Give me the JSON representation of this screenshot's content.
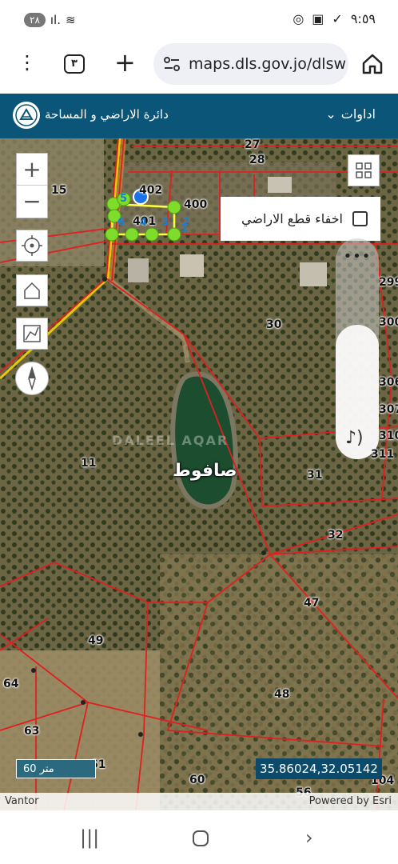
{
  "status": {
    "battery": "٢٨",
    "time": "٩:٥٩"
  },
  "browser": {
    "tab_count": "٣",
    "url": "maps.dls.gov.jo/dlsw"
  },
  "header": {
    "org_name": "دائرة الاراضي و المساحة",
    "tools_label": "اداوات"
  },
  "map": {
    "hide_parcels_label": "اخفاء قطع الاراضي",
    "place_name": "صافوط",
    "watermark": "DALEEL AQAR",
    "scale": "60 متر",
    "coordinates": "35.86024,32.05142",
    "attribution_left": "Vantor",
    "attribution_right": "Powered by Esri",
    "parcels": [
      {
        "id": "p27",
        "label": "27"
      },
      {
        "id": "p28",
        "label": "28"
      },
      {
        "id": "p15",
        "label": "15"
      },
      {
        "id": "p402",
        "label": "402"
      },
      {
        "id": "p400",
        "label": "400"
      },
      {
        "id": "p401",
        "label": "401"
      },
      {
        "id": "p299",
        "label": "299"
      },
      {
        "id": "p30",
        "label": "30"
      },
      {
        "id": "p300",
        "label": "300"
      },
      {
        "id": "p306",
        "label": "306"
      },
      {
        "id": "p307",
        "label": "307"
      },
      {
        "id": "p310",
        "label": "310"
      },
      {
        "id": "p311",
        "label": "311"
      },
      {
        "id": "p11",
        "label": "11"
      },
      {
        "id": "p31",
        "label": "31"
      },
      {
        "id": "p32",
        "label": "32"
      },
      {
        "id": "p47",
        "label": "47"
      },
      {
        "id": "p49",
        "label": "49"
      },
      {
        "id": "p64",
        "label": "64"
      },
      {
        "id": "p48",
        "label": "48"
      },
      {
        "id": "p63",
        "label": "63"
      },
      {
        "id": "p61",
        "label": "61"
      },
      {
        "id": "p60",
        "label": "60"
      },
      {
        "id": "p104",
        "label": "104"
      },
      {
        "id": "p56",
        "label": "56"
      }
    ],
    "vertex_numbers": [
      "1",
      "2",
      "3",
      "4",
      "5",
      "6"
    ]
  },
  "colors": {
    "header_bg": "#0b5579",
    "parcel_line": "#e02020",
    "selection": "#7fdc2b"
  }
}
